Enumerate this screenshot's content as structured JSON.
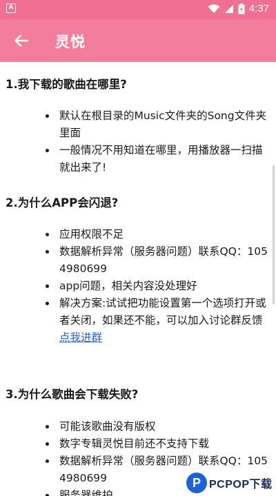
{
  "status_bar": {
    "time": "4:37",
    "notification_icon_letter": "A",
    "icons": [
      "wifi-icon",
      "signal-icon",
      "battery-charging-icon"
    ]
  },
  "app_bar": {
    "title": "灵悦",
    "back_icon": "arrow-left-icon",
    "background_color": "#f47d9d"
  },
  "faq": [
    {
      "title": "1.我下载的歌曲在哪里?",
      "bullets": [
        "默认在根目录的Music文件夹的Song文件夹里面",
        "一般情况不用知道在哪里，用播放器一扫描就出来了!"
      ]
    },
    {
      "title": "2.为什么APP会闪退?",
      "bullets": [
        "应用权限不足",
        "数据解析异常（服务器问题）联系QQ：1054980699",
        "app问题，相关内容没处理好",
        "解决方案:试试把功能设置第一个选项打开或者关闭，如果还不能，可以加入讨论群反馈"
      ],
      "link_label": "点我进群"
    },
    {
      "title": "3.为什么歌曲会下载失败?",
      "bullets": [
        "可能该歌曲没有版权",
        "数字专辑灵悦目前还不支持下载",
        "数据解析异常（服务器问题）联系QQ：1054980699",
        "服务器维护"
      ]
    }
  ],
  "watermark": {
    "logo_letter": "P",
    "text": "PCPOP下载"
  }
}
